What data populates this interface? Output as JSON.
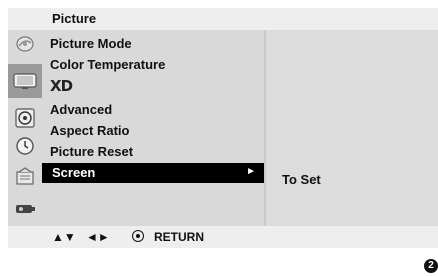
{
  "header": {
    "title": "Picture"
  },
  "sidebar": {
    "icons": [
      {
        "name": "setup-icon",
        "active": false
      },
      {
        "name": "picture-icon",
        "active": true
      },
      {
        "name": "audio-icon",
        "active": false
      },
      {
        "name": "time-icon",
        "active": false
      },
      {
        "name": "option-icon",
        "active": false
      },
      {
        "name": "lock-icon",
        "active": false
      }
    ]
  },
  "menu": {
    "items": [
      {
        "label": "Picture Mode"
      },
      {
        "label": "Color Temperature"
      },
      {
        "label": "XD"
      },
      {
        "label": "Advanced"
      },
      {
        "label": "Aspect Ratio"
      },
      {
        "label": "Picture Reset"
      },
      {
        "label": "Screen",
        "selected": true,
        "arrow": "►"
      }
    ]
  },
  "submenu": {
    "text": "To Set"
  },
  "footer": {
    "updown": "▲▼",
    "leftright": "◄►",
    "return_label": "RETURN"
  },
  "page_badge": "2",
  "colors": {
    "panel": "#d9d9d9",
    "header": "#eeeeee",
    "selected_bg": "#000000",
    "active_icon_bg": "#9a9a9a"
  }
}
